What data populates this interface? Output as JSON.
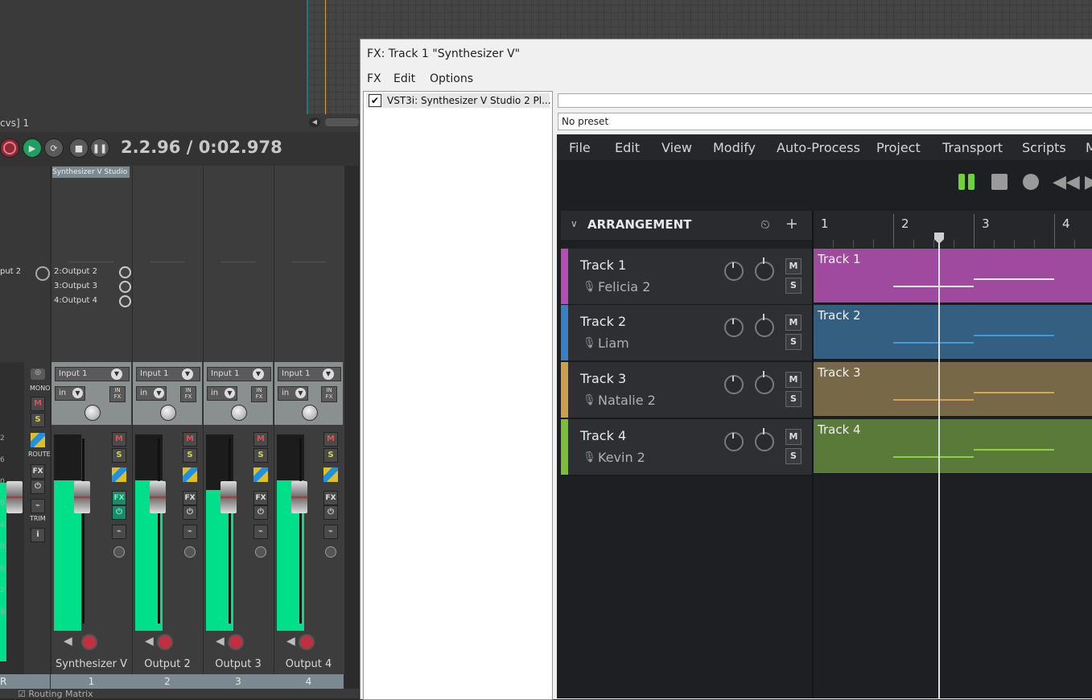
{
  "daw": {
    "window_label": "cvs] 1",
    "time": "2.2.96 / 0:02.978",
    "fx_tooltip": "Synthesizer V Studio",
    "left_output": "put 2",
    "routing_matrix": "Routing Matrix",
    "master_labels": {
      "mono": "MONO",
      "route": "ROUTE",
      "trim": "TRIM",
      "fx": "FX",
      "m": "M",
      "s": "S",
      "i": "i",
      "r": "R"
    },
    "outputs": [
      "2:Output 2",
      "3:Output 3",
      "4:Output 4"
    ],
    "strips": [
      {
        "name": "Synthesizer V",
        "number": "1",
        "input": "Input 1",
        "in": "in",
        "db": "-9.7",
        "m": "M",
        "s": "S",
        "fx": "FX",
        "infx": "IN FX",
        "meter": 0.78
      },
      {
        "name": "Output 2",
        "number": "2",
        "input": "Input 1",
        "in": "in",
        "db": "-9.7",
        "m": "M",
        "s": "S",
        "fx": "FX",
        "infx": "IN FX",
        "meter": 0.78
      },
      {
        "name": "Output 3",
        "number": "3",
        "input": "Input 1",
        "in": "in",
        "db": "-14.0",
        "m": "M",
        "s": "S",
        "fx": "FX",
        "infx": "IN FX",
        "meter": 0.73
      },
      {
        "name": "Output 4",
        "number": "4",
        "input": "Input 1",
        "in": "in",
        "db": "-10.4",
        "m": "M",
        "s": "S",
        "fx": "FX",
        "infx": "IN FX",
        "meter": 0.78
      }
    ],
    "db_scale": [
      "2",
      "6",
      "0",
      "8",
      "4",
      "0",
      "6",
      "2",
      "8"
    ],
    "colors": {
      "meter": "#00e08a",
      "accent_red": "#c03040"
    }
  },
  "fx_window": {
    "title": "FX: Track 1 \"Synthesizer V\"",
    "menu": [
      "FX",
      "Edit",
      "Options"
    ],
    "plugin": "VST3i: Synthesizer V Studio 2 Pl...",
    "preset": "No preset"
  },
  "synthv": {
    "menu": [
      "File",
      "Edit",
      "View",
      "Modify",
      "Auto-Process",
      "Project",
      "Transport",
      "Scripts",
      "M"
    ],
    "arrangement_label": "ARRANGEMENT",
    "ruler": [
      "1",
      "2",
      "3",
      "4"
    ],
    "tracks": [
      {
        "name": "Track 1",
        "singer": "Felicia 2",
        "color": "#b24fb0",
        "lane": "#9f4a9e",
        "note": "#e8e8e8",
        "m": "M",
        "s": "S"
      },
      {
        "name": "Track 2",
        "singer": "Liam",
        "color": "#3a7fc0",
        "lane": "#355f80",
        "note": "#3b9ae0",
        "m": "M",
        "s": "S"
      },
      {
        "name": "Track 3",
        "singer": "Natalie 2",
        "color": "#c9a050",
        "lane": "#776847",
        "note": "#d6a448",
        "m": "M",
        "s": "S"
      },
      {
        "name": "Track 4",
        "singer": "Kevin 2",
        "color": "#7dbb3a",
        "lane": "#5a7a3a",
        "note": "#8fd040",
        "m": "M",
        "s": "S"
      }
    ],
    "colors": {
      "play_green": "#6ed33a"
    }
  }
}
